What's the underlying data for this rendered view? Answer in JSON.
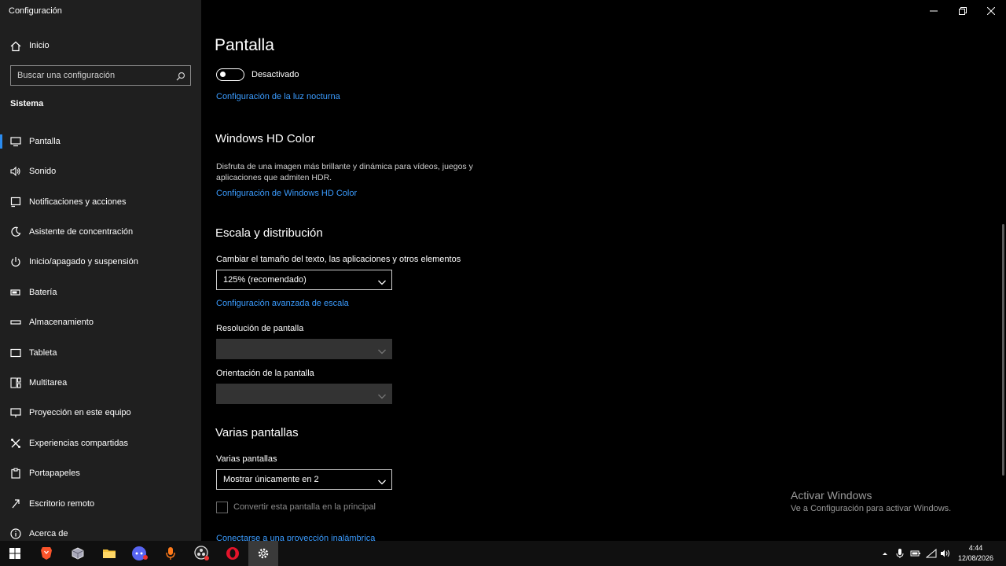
{
  "window": {
    "title": "Configuración"
  },
  "sidebar": {
    "home_label": "Inicio",
    "search_placeholder": "Buscar una configuración",
    "section_title": "Sistema",
    "items": [
      {
        "label": "Pantalla",
        "icon": "monitor-icon",
        "active": true
      },
      {
        "label": "Sonido",
        "icon": "speaker-icon"
      },
      {
        "label": "Notificaciones y acciones",
        "icon": "notification-icon"
      },
      {
        "label": "Asistente de concentración",
        "icon": "moon-icon"
      },
      {
        "label": "Inicio/apagado y suspensión",
        "icon": "power-icon"
      },
      {
        "label": "Batería",
        "icon": "battery-icon"
      },
      {
        "label": "Almacenamiento",
        "icon": "storage-icon"
      },
      {
        "label": "Tableta",
        "icon": "tablet-icon"
      },
      {
        "label": "Multitarea",
        "icon": "multitask-icon"
      },
      {
        "label": "Proyección en este equipo",
        "icon": "projection-icon"
      },
      {
        "label": "Experiencias compartidas",
        "icon": "shared-experience-icon"
      },
      {
        "label": "Portapapeles",
        "icon": "clipboard-icon"
      },
      {
        "label": "Escritorio remoto",
        "icon": "remote-desktop-icon"
      },
      {
        "label": "Acerca de",
        "icon": "info-icon"
      }
    ]
  },
  "content": {
    "page_title": "Pantalla",
    "night_light": {
      "toggle_state": "Desactivado",
      "settings_link": "Configuración de la luz nocturna"
    },
    "hd_color": {
      "heading": "Windows HD Color",
      "description": "Disfruta de una imagen más brillante y dinámica para vídeos, juegos y aplicaciones que admiten HDR.",
      "link": "Configuración de Windows HD Color"
    },
    "scale": {
      "heading": "Escala y distribución",
      "size_label": "Cambiar el tamaño del texto, las aplicaciones y otros elementos",
      "size_value": "125% (recomendado)",
      "advanced_link": "Configuración avanzada de escala",
      "resolution_label": "Resolución de pantalla",
      "orientation_label": "Orientación de la pantalla"
    },
    "multi_display": {
      "heading": "Varias pantallas",
      "label": "Varias pantallas",
      "value": "Mostrar únicamente en 2",
      "main_checkbox_label": "Convertir esta pantalla en la principal",
      "wireless_link": "Conectarse a una proyección inalámbrica"
    },
    "activation": {
      "title": "Activar Windows",
      "subtitle": "Ve a Configuración para activar Windows."
    }
  },
  "taskbar": {
    "apps": [
      "windows-start-icon",
      "brave-browser-icon",
      "virtualbox-icon",
      "file-explorer-icon",
      "discord-icon",
      "microphone-recorder-icon",
      "obs-icon",
      "opera-icon",
      "settings-gear-icon"
    ],
    "time": "4:44",
    "date": "12/08/2026"
  },
  "colors": {
    "sidebar_bg": "#1f1f1f",
    "content_bg": "#000000",
    "accent": "#2b8cf0",
    "link": "#3b9cff"
  }
}
